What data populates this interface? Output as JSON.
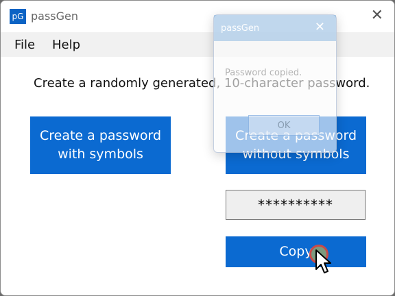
{
  "window": {
    "icon_text": "pG",
    "title": "passGen",
    "close_glyph": "✕"
  },
  "menu": {
    "items": [
      "File",
      "Help"
    ]
  },
  "main": {
    "prompt": "Create a randomly generated, 10-character password.",
    "btn_with_symbols": [
      "Create a password",
      "with symbols"
    ],
    "btn_without_symbols": [
      "Create a password",
      "without symbols"
    ],
    "password_display": "**********",
    "copy_label": "Copy"
  },
  "dialog": {
    "title": "passGen",
    "close_glyph": "✕",
    "message": "Password copied.",
    "ok_label": "OK"
  },
  "colors": {
    "accent": "#0b6ad1",
    "click_indicator_ring": "#c94a48",
    "click_indicator_fill": "#7c9a7e"
  },
  "icons": {
    "app": "pg-app-icon",
    "cursor": "arrow-cursor-icon"
  }
}
